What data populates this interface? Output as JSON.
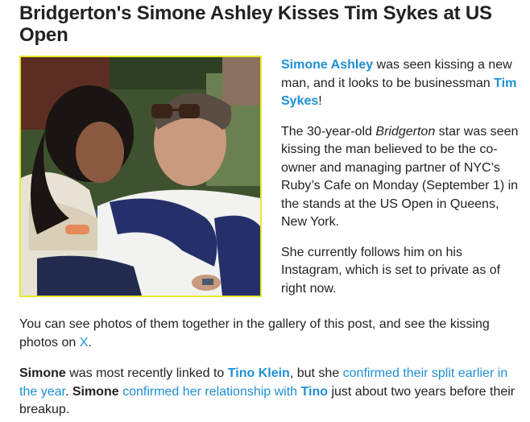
{
  "article": {
    "headline": "Bridgerton's Simone Ashley Kisses Tim Sykes at US Open",
    "p1": {
      "name_link": "Simone Ashley",
      "text1": " was seen kissing a new man, and it looks to be businessman ",
      "name2_link": "Tim Sykes",
      "text2": "!"
    },
    "p2": {
      "text1": "The 30-year-old ",
      "italic": "Bridgerton",
      "text2": " star was seen kissing the man believed to be the co-owner and managing partner of NYC’s Ruby’s Cafe on Monday (September 1) in the stands at the US Open in Queens, New York."
    },
    "p3": {
      "text": "She currently follows him on his Instagram, which is set to private as of right now."
    },
    "p4": {
      "text1": "You can see photos of them together in the gallery of this post, and see the kissing photos on ",
      "link": "X",
      "text2": "."
    },
    "p5": {
      "bold1": "Simone",
      "text1": " was most recently linked to ",
      "name_link": "Tino Klein",
      "text2": ", but she ",
      "link1": "confirmed their split earlier in the year",
      "text3": ". ",
      "bold2": "Simone",
      "text4": " ",
      "link2": "confirmed her relationship with ",
      "name_link2": "Tino",
      "text5": " just about two years before their breakup."
    }
  },
  "colors": {
    "link": "#1e8fd4",
    "text": "#222222",
    "photo_border": "#e5ea2a"
  }
}
